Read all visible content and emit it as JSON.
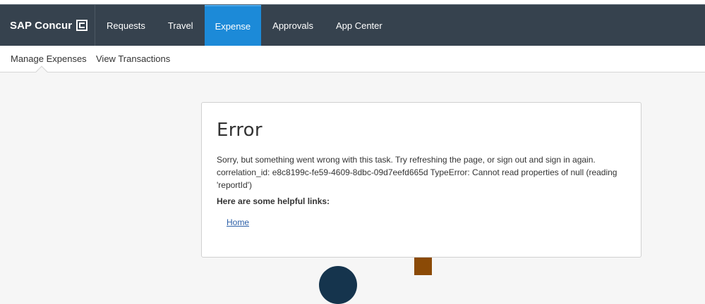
{
  "header": {
    "brand": "SAP Concur",
    "nav": [
      {
        "label": "Requests"
      },
      {
        "label": "Travel"
      },
      {
        "label": "Expense",
        "active": true
      },
      {
        "label": "Approvals"
      },
      {
        "label": "App Center"
      }
    ]
  },
  "subnav": {
    "items": [
      {
        "label": "Manage Expenses",
        "active": true
      },
      {
        "label": "View Transactions"
      }
    ]
  },
  "error": {
    "title": "Error",
    "message": "Sorry, but something went wrong with this task. Try refreshing the page, or sign out and sign in again. correlation_id: e8c8199c-fe59-4609-8dbc-09d7eefd665d TypeError: Cannot read properties of null (reading 'reportId')",
    "help_heading": "Here are some helpful links:",
    "links": [
      {
        "label": "Home"
      }
    ]
  },
  "colors": {
    "topbar": "#36424e",
    "active_tab": "#1c8ad8",
    "link": "#2b5fa7"
  },
  "icons": [
    "concur-logo-icon"
  ]
}
